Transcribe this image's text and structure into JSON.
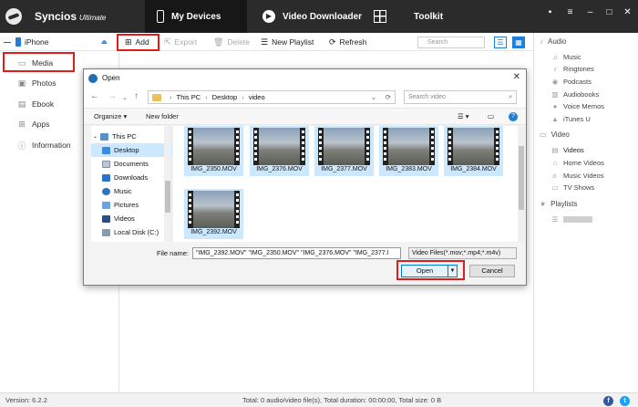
{
  "app": {
    "name": "Syncios",
    "edition": "Ultimate"
  },
  "tabs": [
    {
      "label": "My Devices",
      "icon": "phone-icon"
    },
    {
      "label": "Video Downloader",
      "icon": "play-icon"
    },
    {
      "label": "Toolkit",
      "icon": "grid-icon"
    }
  ],
  "window_controls": [
    "chat-icon",
    "menu-icon",
    "minimize-icon",
    "maximize-icon",
    "close-icon"
  ],
  "toolbar": {
    "device": "iPhone",
    "add": "Add",
    "export": "Export",
    "delete": "Delete",
    "new_playlist": "New Playlist",
    "refresh": "Refresh",
    "search_placeholder": "Search"
  },
  "sidebar": {
    "items": [
      {
        "label": "Media",
        "icon": "media-icon"
      },
      {
        "label": "Photos",
        "icon": "photo-icon"
      },
      {
        "label": "Ebook",
        "icon": "book-icon"
      },
      {
        "label": "Apps",
        "icon": "apps-icon"
      },
      {
        "label": "Information",
        "icon": "info-icon"
      }
    ]
  },
  "rightpanel": {
    "audio_label": "Audio",
    "audio_items": [
      "Music",
      "Ringtones",
      "Podcasts",
      "Audiobooks",
      "Voice Memos",
      "iTunes U"
    ],
    "video_label": "Video",
    "video_items": [
      "Videos",
      "Home Videos",
      "Music Videos",
      "TV Shows"
    ],
    "playlists_label": "Playlists"
  },
  "dialog": {
    "title": "Open",
    "path": [
      "This PC",
      "Desktop",
      "video"
    ],
    "search_placeholder": "Search video",
    "organize": "Organize",
    "new_folder": "New folder",
    "nav_items": [
      {
        "label": "This PC",
        "icon": "pc-icon"
      },
      {
        "label": "Desktop",
        "icon": "desktop-icon"
      },
      {
        "label": "Documents",
        "icon": "documents-icon"
      },
      {
        "label": "Downloads",
        "icon": "downloads-icon"
      },
      {
        "label": "Music",
        "icon": "music-icon"
      },
      {
        "label": "Pictures",
        "icon": "pictures-icon"
      },
      {
        "label": "Videos",
        "icon": "videos-icon"
      },
      {
        "label": "Local Disk (C:)",
        "icon": "disk-icon"
      }
    ],
    "files": [
      "IMG_2350.MOV",
      "IMG_2376.MOV",
      "IMG_2377.MOV",
      "IMG_2383.MOV",
      "IMG_2384.MOV",
      "IMG_2392.MOV"
    ],
    "file_name_label": "File name:",
    "file_name_value": "\"IMG_2392.MOV\" \"IMG_2350.MOV\" \"IMG_2376.MOV\" \"IMG_2377.I",
    "file_type": "Video Files(*.mov;*.mp4;*.m4v)",
    "open": "Open",
    "cancel": "Cancel"
  },
  "status": {
    "version": "Version: 6.2.2",
    "summary": "Total: 0 audio/video file(s), Total duration: 00:00:00, Total size: 0 B"
  },
  "colors": {
    "accent": "#1e7fd8",
    "highlight": "#e11c1c",
    "topbar": "#2b2b2b"
  }
}
